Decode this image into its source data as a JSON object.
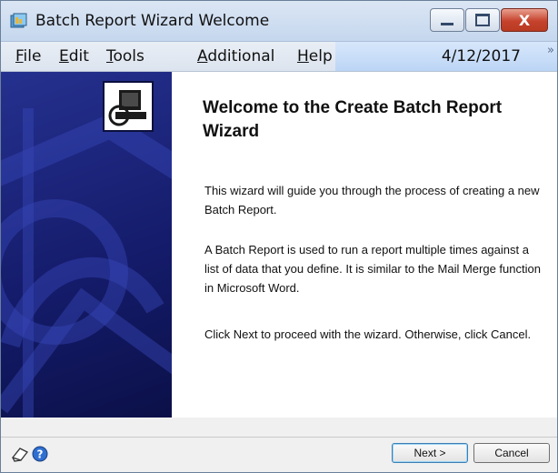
{
  "window": {
    "title": "Batch Report Wizard Welcome"
  },
  "menu": {
    "items": [
      {
        "key": "F",
        "rest": "ile"
      },
      {
        "key": "E",
        "rest": "dit"
      },
      {
        "key": "T",
        "rest": "ools"
      },
      {
        "key": "A",
        "rest": "dditional"
      },
      {
        "key": "H",
        "rest": "elp"
      }
    ],
    "date": "4/12/2017",
    "overflow_glyph": "»"
  },
  "wizard": {
    "title": "Welcome to the Create Batch Report Wizard",
    "paragraphs": [
      "This wizard will guide you through the process of creating a new Batch Report.",
      "A Batch Report is used to run a report multiple times against a list of data that you define.  It is similar to the Mail Merge function in Microsoft Word.",
      "Click Next to proceed with the wizard. Otherwise, click Cancel."
    ]
  },
  "buttons": {
    "next": "Next >",
    "cancel": "Cancel"
  },
  "icons": {
    "app": "report-wizard-icon",
    "logo": "computer-disc-icon",
    "footer_left": "note-icon",
    "footer_help": "help-icon"
  },
  "colors": {
    "side_panel": "#1a237e",
    "close_button": "#c5422c",
    "menu_highlight": "#c9ddf7"
  }
}
